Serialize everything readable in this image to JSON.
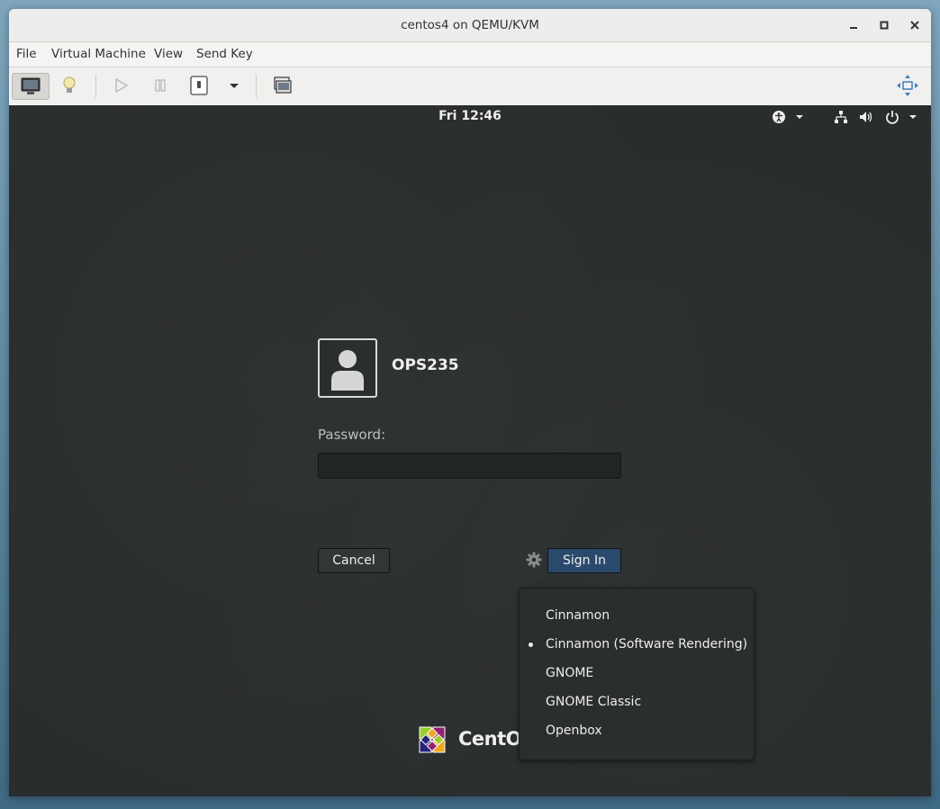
{
  "window": {
    "title": "centos4 on QEMU/KVM"
  },
  "menubar": {
    "items": [
      "File",
      "Virtual Machine",
      "View",
      "Send Key"
    ]
  },
  "toolbar": {
    "icons": [
      "console-icon",
      "lightbulb-icon",
      "run-icon",
      "pause-icon",
      "shutdown-icon",
      "dropdown-arrow-icon",
      "screenshot-icon",
      "fullscreen-icon"
    ]
  },
  "topbar": {
    "clock": "Fri 12:46"
  },
  "login": {
    "username": "OPS235",
    "password_label": "Password:",
    "password_value": "",
    "cancel_label": "Cancel",
    "signin_label": "Sign In"
  },
  "session_menu": {
    "items": [
      {
        "label": "Cinnamon",
        "selected": false
      },
      {
        "label": "Cinnamon (Software Rendering)",
        "selected": true
      },
      {
        "label": "GNOME",
        "selected": false
      },
      {
        "label": "GNOME Classic",
        "selected": false
      },
      {
        "label": "Openbox",
        "selected": false
      }
    ]
  },
  "branding": {
    "logo_text": "CentOS"
  },
  "colors": {
    "signin_button": "#294a6c",
    "console_background": "#2a2d2d"
  }
}
